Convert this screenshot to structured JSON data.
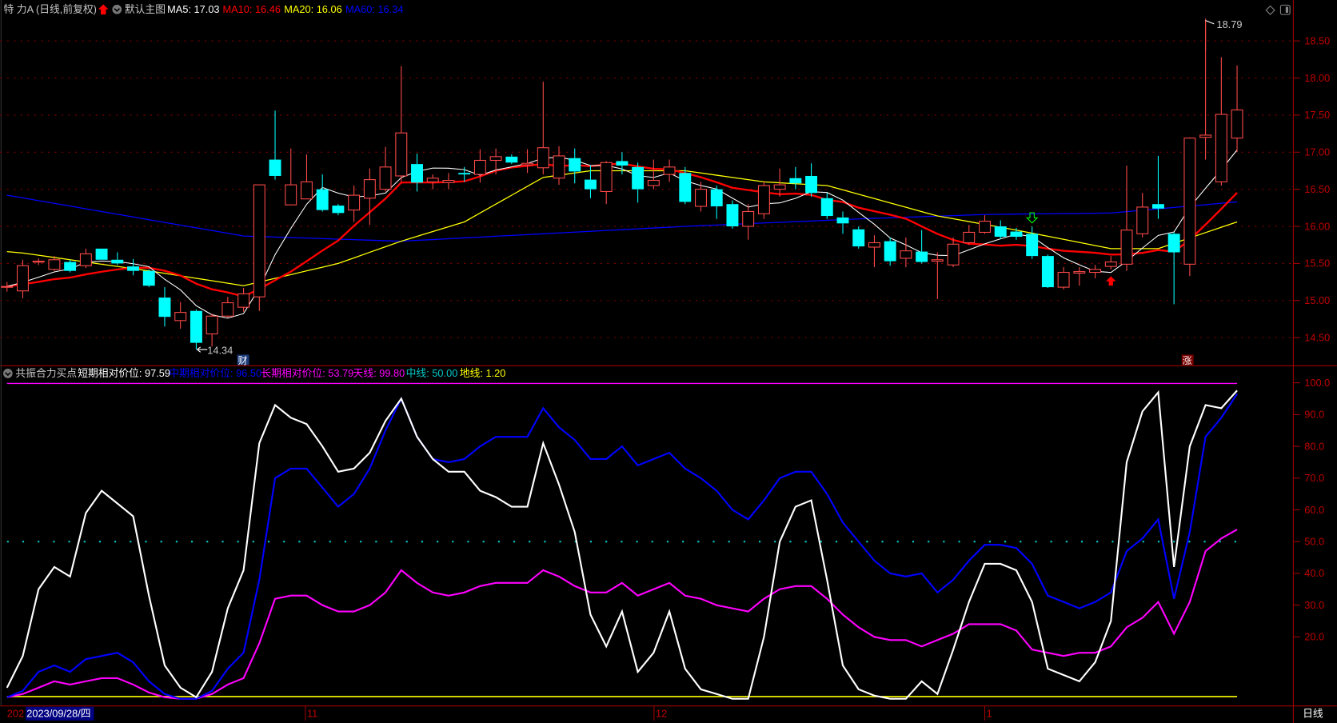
{
  "header": {
    "title": "特 力A (日线,前复权)",
    "template": "默认主图",
    "ma5": "MA5: 17.03",
    "ma10": "MA10: 16.46",
    "ma20": "MA20: 16.06",
    "ma60": "MA60: 16.34"
  },
  "annotations": {
    "high": "18.79",
    "low": "14.34",
    "badge_cai": "财",
    "badge_zhang": "涨"
  },
  "indicator": {
    "name": "共振合力买点",
    "short": "短期相对价位: 97.59",
    "mid": "中期相对价位: 96.50",
    "long": "长期相对价位: 53.79",
    "sky": "天线: 99.80",
    "middle": "中线: 50.00",
    "ground": "地线: 1.20"
  },
  "time_axis": {
    "start": "202",
    "cursor_date": "2023/09/28/四",
    "labels": [
      "11",
      "12",
      "1"
    ],
    "period": "日线"
  },
  "colors": {
    "up": "#ff4a4a",
    "down": "#00ffff",
    "ma5": "#ffffff",
    "ma10": "#ff0000",
    "ma20": "#ffff00",
    "ma60": "#0000ff",
    "short": "#ffffff",
    "mid": "#0000ff",
    "long": "#ff00ff",
    "sky": "#ff00ff",
    "middle": "#00c8c8",
    "ground": "#ffff00"
  },
  "chart_data": [
    {
      "type": "candlestick",
      "title": "特 力A (日线,前复权)",
      "yticks": [
        "18.50",
        "18.00",
        "17.50",
        "17.00",
        "16.50",
        "16.00",
        "15.50",
        "15.00",
        "14.50"
      ],
      "ylim": [
        14.2,
        18.9
      ],
      "ohlc": [
        [
          15.19,
          15.25,
          15.12,
          15.19
        ],
        [
          15.13,
          15.55,
          15.03,
          15.47
        ],
        [
          15.52,
          15.57,
          15.48,
          15.53
        ],
        [
          15.42,
          15.6,
          15.4,
          15.55
        ],
        [
          15.52,
          15.55,
          15.38,
          15.4
        ],
        [
          15.47,
          15.7,
          15.44,
          15.63
        ],
        [
          15.7,
          15.7,
          15.55,
          15.55
        ],
        [
          15.55,
          15.65,
          15.48,
          15.5
        ],
        [
          15.46,
          15.56,
          15.34,
          15.4
        ],
        [
          15.4,
          15.42,
          15.18,
          15.2
        ],
        [
          15.04,
          15.18,
          14.65,
          14.78
        ],
        [
          14.73,
          14.98,
          14.62,
          14.84
        ],
        [
          14.86,
          14.88,
          14.34,
          14.43
        ],
        [
          14.55,
          14.82,
          14.38,
          14.79
        ],
        [
          14.79,
          15.05,
          14.77,
          14.97
        ],
        [
          14.91,
          15.17,
          14.85,
          15.09
        ],
        [
          15.05,
          16.56,
          14.86,
          16.56
        ],
        [
          16.9,
          17.56,
          16.63,
          16.68
        ],
        [
          16.29,
          17.05,
          16.3,
          16.56
        ],
        [
          16.37,
          16.97,
          16.37,
          16.6
        ],
        [
          16.5,
          16.7,
          16.2,
          16.22
        ],
        [
          16.28,
          16.3,
          16.15,
          16.18
        ],
        [
          16.22,
          16.55,
          16.06,
          16.42
        ],
        [
          16.38,
          16.78,
          16.02,
          16.63
        ],
        [
          16.5,
          17.07,
          16.47,
          16.8
        ],
        [
          16.68,
          18.16,
          16.6,
          17.26
        ],
        [
          16.84,
          16.98,
          16.47,
          16.59
        ],
        [
          16.6,
          16.7,
          16.5,
          16.65
        ],
        [
          16.59,
          16.72,
          16.5,
          16.62
        ],
        [
          16.72,
          16.8,
          16.6,
          16.7
        ],
        [
          16.7,
          17.04,
          16.59,
          16.89
        ],
        [
          16.89,
          17.05,
          16.7,
          16.94
        ],
        [
          16.94,
          16.97,
          16.84,
          16.86
        ],
        [
          16.83,
          17.04,
          16.72,
          16.85
        ],
        [
          16.79,
          17.95,
          16.7,
          17.06
        ],
        [
          16.65,
          17.08,
          16.56,
          16.95
        ],
        [
          16.92,
          17.05,
          16.58,
          16.74
        ],
        [
          16.63,
          16.82,
          16.38,
          16.5
        ],
        [
          16.47,
          16.88,
          16.3,
          16.86
        ],
        [
          16.88,
          17.0,
          16.7,
          16.82
        ],
        [
          16.8,
          16.86,
          16.32,
          16.5
        ],
        [
          16.55,
          16.9,
          16.5,
          16.62
        ],
        [
          16.7,
          16.9,
          16.6,
          16.8
        ],
        [
          16.72,
          16.8,
          16.3,
          16.33
        ],
        [
          16.27,
          16.6,
          16.2,
          16.5
        ],
        [
          16.5,
          16.55,
          16.1,
          16.27
        ],
        [
          16.3,
          16.35,
          15.97,
          16.0
        ],
        [
          16.0,
          16.3,
          15.82,
          16.2
        ],
        [
          16.17,
          16.6,
          16.1,
          16.55
        ],
        [
          16.5,
          16.78,
          16.4,
          16.56
        ],
        [
          16.65,
          16.8,
          16.5,
          16.58
        ],
        [
          16.68,
          16.85,
          16.4,
          16.45
        ],
        [
          16.38,
          16.45,
          16.1,
          16.14
        ],
        [
          16.12,
          16.2,
          15.9,
          16.04
        ],
        [
          15.96,
          16.0,
          15.7,
          15.73
        ],
        [
          15.72,
          15.88,
          15.45,
          15.78
        ],
        [
          15.8,
          15.85,
          15.47,
          15.53
        ],
        [
          15.57,
          15.85,
          15.45,
          15.67
        ],
        [
          15.66,
          15.95,
          15.5,
          15.52
        ],
        [
          15.53,
          15.65,
          15.02,
          15.55
        ],
        [
          15.48,
          15.85,
          15.45,
          15.76
        ],
        [
          15.78,
          16.02,
          15.75,
          15.92
        ],
        [
          15.92,
          16.15,
          15.9,
          16.07
        ],
        [
          16.0,
          16.08,
          15.83,
          15.86
        ],
        [
          15.93,
          15.98,
          15.82,
          15.86
        ],
        [
          15.9,
          16.0,
          15.56,
          15.6
        ],
        [
          15.6,
          15.62,
          15.17,
          15.18
        ],
        [
          15.18,
          15.45,
          15.15,
          15.38
        ],
        [
          15.37,
          15.45,
          15.2,
          15.39
        ],
        [
          15.38,
          15.48,
          15.3,
          15.42
        ],
        [
          15.46,
          15.6,
          15.42,
          15.52
        ],
        [
          15.49,
          16.82,
          15.4,
          15.95
        ],
        [
          15.9,
          16.45,
          15.85,
          16.26
        ],
        [
          16.3,
          16.95,
          16.1,
          16.24
        ],
        [
          15.9,
          15.92,
          14.95,
          15.65
        ],
        [
          15.49,
          17.2,
          15.33,
          17.19
        ],
        [
          17.2,
          18.79,
          16.9,
          17.23
        ],
        [
          16.6,
          18.28,
          16.55,
          17.51
        ],
        [
          17.19,
          18.17,
          17.0,
          17.57
        ]
      ],
      "ma20_points": [
        [
          0,
          15.66
        ],
        [
          1,
          15.64
        ],
        [
          9,
          15.4
        ],
        [
          15,
          15.2
        ],
        [
          21,
          15.5
        ],
        [
          25,
          15.8
        ],
        [
          29,
          16.06
        ],
        [
          34,
          16.66
        ],
        [
          37,
          16.75
        ],
        [
          43,
          16.75
        ],
        [
          48,
          16.6
        ],
        [
          52,
          16.55
        ],
        [
          59,
          16.14
        ],
        [
          64,
          15.95
        ],
        [
          70,
          15.7
        ],
        [
          73,
          15.7
        ],
        [
          78,
          16.06
        ]
      ],
      "ma60_points": [
        [
          0,
          16.42
        ],
        [
          15,
          15.87
        ],
        [
          25,
          15.8
        ],
        [
          43,
          16.0
        ],
        [
          54,
          16.1
        ],
        [
          62,
          16.16
        ],
        [
          70,
          16.18
        ],
        [
          78,
          16.33
        ]
      ],
      "markers": [
        {
          "index": 70,
          "type": "buy-arrow"
        },
        {
          "index": 65,
          "type": "sell-arrow"
        }
      ]
    },
    {
      "type": "line",
      "title": "共振合力买点",
      "yticks": [
        "100.0",
        "90.0",
        "80.0",
        "70.0",
        "60.0",
        "50.0",
        "40.0",
        "30.0",
        "20.0"
      ],
      "ylim": [
        0,
        100
      ],
      "series": [
        {
          "name": "短期相对价位",
          "values": [
            4,
            14,
            35,
            42,
            39,
            59,
            66,
            62,
            58,
            33,
            11,
            4,
            1,
            9,
            29,
            41,
            81,
            93,
            89,
            87,
            80,
            72,
            73,
            78,
            88,
            95,
            83,
            76,
            72,
            72,
            66,
            64,
            61,
            61,
            81,
            68,
            53,
            27,
            17,
            28,
            9,
            15,
            28,
            10,
            3.5,
            2,
            0.5,
            0.5,
            20,
            50,
            61,
            63,
            38,
            11,
            3.5,
            1.5,
            0.5,
            0.5,
            6,
            2,
            16,
            31,
            43,
            43,
            41,
            31,
            10,
            8,
            6,
            12,
            25,
            75,
            91,
            97,
            42,
            80,
            93,
            92,
            97.59
          ]
        },
        {
          "name": "中期相对价位",
          "values": [
            1,
            3,
            9,
            11,
            9,
            13,
            14,
            15,
            12,
            6,
            2,
            0.5,
            0.5,
            3,
            10,
            15,
            38,
            70,
            73,
            73,
            67,
            61,
            65,
            73,
            85,
            95,
            83,
            76,
            75,
            76,
            80,
            83,
            83,
            83,
            92,
            86,
            82,
            76,
            76,
            80,
            74,
            76,
            78,
            73,
            70,
            66,
            60,
            57,
            63,
            70,
            72,
            72,
            65,
            56,
            50,
            44,
            40,
            39,
            40,
            34,
            38,
            44,
            49,
            49,
            48,
            43,
            33,
            31,
            29,
            31,
            34,
            47,
            51,
            57,
            32,
            53,
            83,
            89,
            96.5
          ]
        },
        {
          "name": "长期相对价位",
          "values": [
            1,
            2,
            4,
            6,
            5,
            6,
            7,
            7,
            5,
            2.5,
            1,
            0.5,
            0.5,
            2,
            5,
            7,
            18,
            32,
            33,
            33,
            30,
            28,
            28,
            30,
            34,
            41,
            37,
            34,
            33,
            34,
            36,
            37,
            37,
            37,
            41,
            39,
            36,
            34,
            34,
            37,
            33,
            35,
            37,
            33,
            32,
            30,
            29,
            28,
            32,
            35,
            36,
            36,
            32,
            27,
            23,
            20,
            19,
            19,
            17,
            19,
            21,
            24,
            24,
            24,
            22,
            16,
            15,
            14,
            15,
            15,
            17,
            23,
            26,
            31,
            21,
            31,
            47,
            51,
            53.79
          ]
        },
        {
          "name": "天线",
          "constant": 99.8
        },
        {
          "name": "中线",
          "constant": 50.0
        },
        {
          "name": "地线",
          "constant": 1.2
        }
      ]
    }
  ]
}
